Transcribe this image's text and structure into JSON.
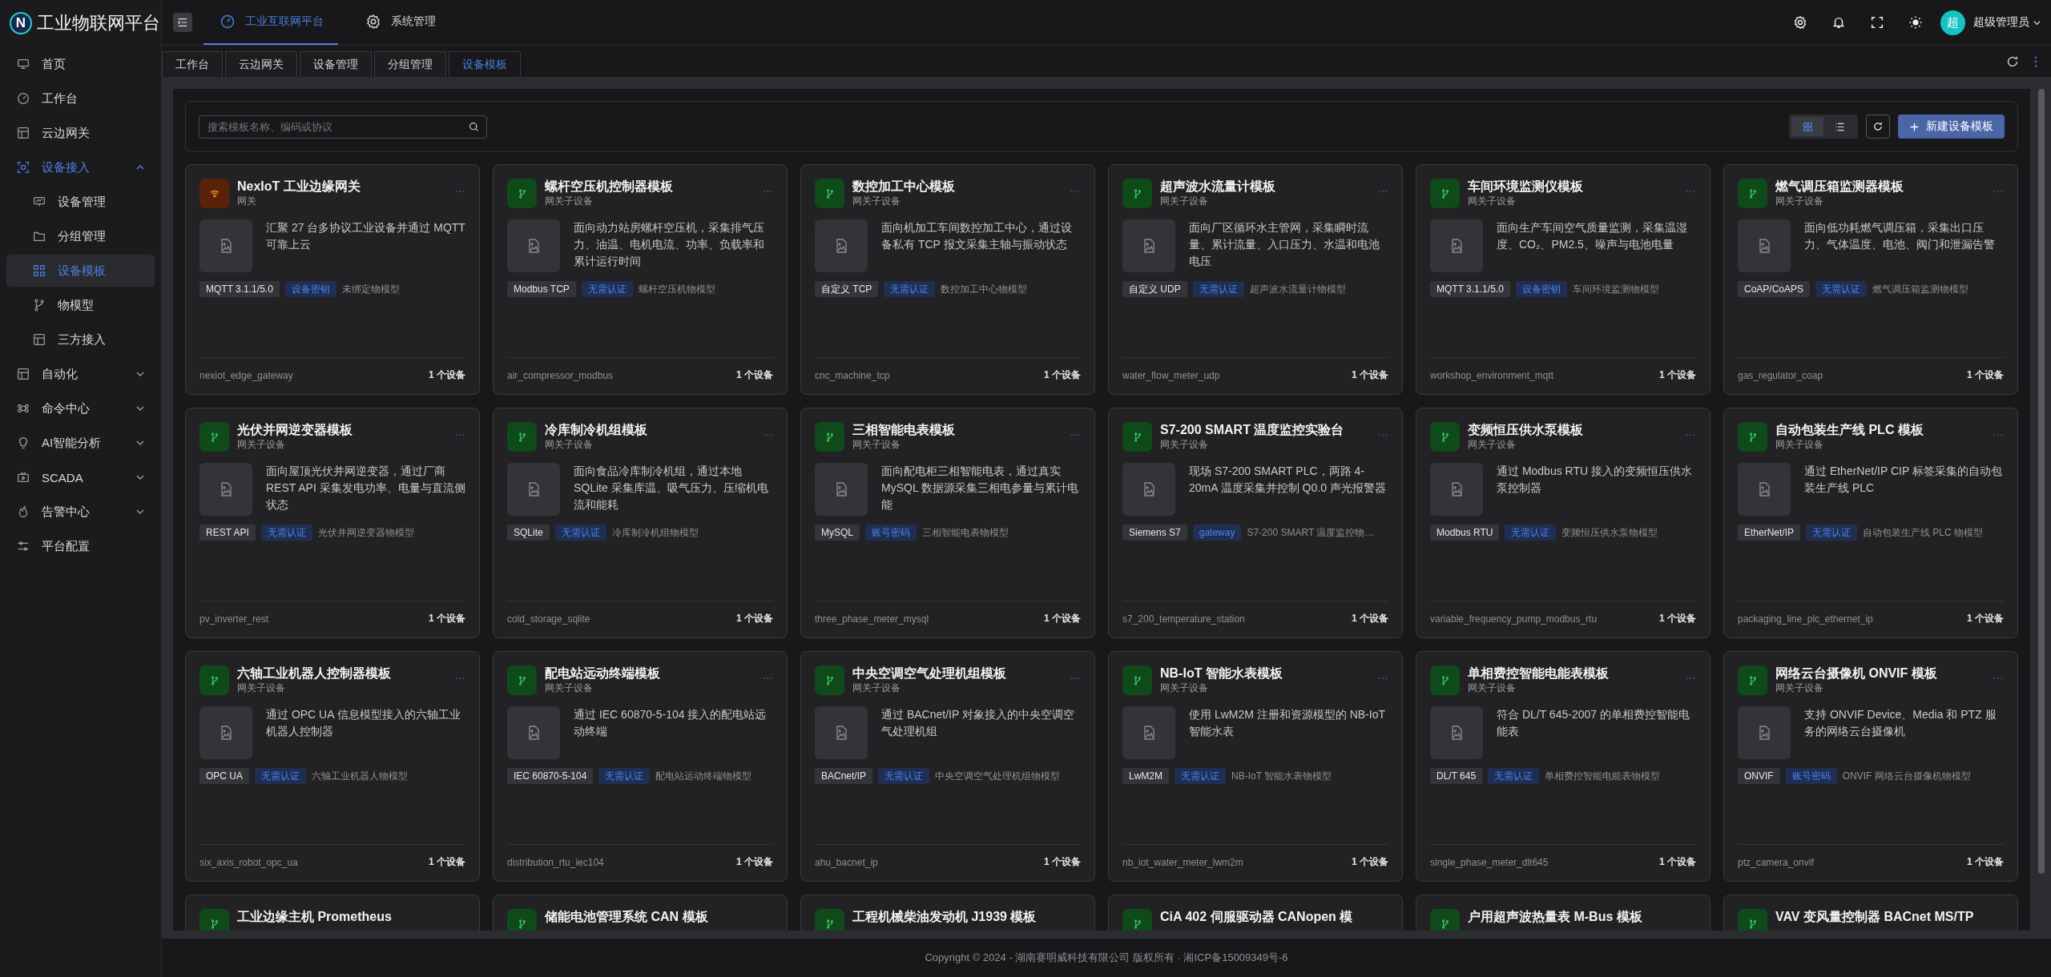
{
  "brand": {
    "logo_mark": "N",
    "title": "工业物联网平台"
  },
  "sidebar": {
    "items": [
      {
        "label": "首页",
        "kind": "link"
      },
      {
        "label": "工作台",
        "kind": "link"
      },
      {
        "label": "云边网关",
        "kind": "link"
      },
      {
        "label": "设备接入",
        "kind": "group",
        "expanded": true,
        "children": [
          {
            "label": "设备管理",
            "selected": false
          },
          {
            "label": "分组管理",
            "selected": false
          },
          {
            "label": "设备模板",
            "selected": true
          },
          {
            "label": "物模型",
            "selected": false
          },
          {
            "label": "三方接入",
            "selected": false
          }
        ]
      },
      {
        "label": "自动化",
        "kind": "group",
        "expanded": false
      },
      {
        "label": "命令中心",
        "kind": "group",
        "expanded": false
      },
      {
        "label": "AI智能分析",
        "kind": "group",
        "expanded": false
      },
      {
        "label": "SCADA",
        "kind": "group",
        "expanded": false
      },
      {
        "label": "告警中心",
        "kind": "group",
        "expanded": false
      },
      {
        "label": "平台配置",
        "kind": "link"
      }
    ]
  },
  "top_nav": [
    {
      "label": "工业互联网平台",
      "selected": true
    },
    {
      "label": "系统管理",
      "selected": false
    }
  ],
  "user": {
    "avatar_text": "超",
    "name": "超级管理员"
  },
  "tabs": [
    {
      "label": "工作台",
      "selected": false
    },
    {
      "label": "云边网关",
      "selected": false
    },
    {
      "label": "设备管理",
      "selected": false
    },
    {
      "label": "分组管理",
      "selected": false
    },
    {
      "label": "设备模板",
      "selected": true
    }
  ],
  "toolbar": {
    "search": {
      "placeholder": "搜索模板名称、编码或协议"
    },
    "view_modes": [
      {
        "kind": "grid",
        "selected": true
      },
      {
        "kind": "list",
        "selected": false
      }
    ],
    "create_button": "新建设备模板"
  },
  "cards": [
    {
      "kind": "gateway",
      "title": "NexIoT 工业边缘网关",
      "type": "网关",
      "description": "汇聚 27 台多协议工业设备并通过 MQTT 可靠上云",
      "protocol": "MQTT 3.1.1/5.0",
      "auth": "设备密钥",
      "model": "未绑定物模型",
      "code": "nexiot_edge_gateway",
      "count": "1 个设备"
    },
    {
      "kind": "subdevice",
      "title": "螺杆空压机控制器模板",
      "type": "网关子设备",
      "description": "面向动力站房螺杆空压机，采集排气压力、油温、电机电流、功率、负载率和累计运行时间",
      "protocol": "Modbus TCP",
      "auth": "无需认证",
      "model": "螺杆空压机物模型",
      "code": "air_compressor_modbus",
      "count": "1 个设备"
    },
    {
      "kind": "subdevice",
      "title": "数控加工中心模板",
      "type": "网关子设备",
      "description": "面向机加工车间数控加工中心，通过设备私有 TCP 报文采集主轴与振动状态",
      "protocol": "自定义 TCP",
      "auth": "无需认证",
      "model": "数控加工中心物模型",
      "code": "cnc_machine_tcp",
      "count": "1 个设备"
    },
    {
      "kind": "subdevice",
      "title": "超声波水流量计模板",
      "type": "网关子设备",
      "description": "面向厂区循环水主管网，采集瞬时流量、累计流量、入口压力、水温和电池电压",
      "protocol": "自定义 UDP",
      "auth": "无需认证",
      "model": "超声波水流量计物模型",
      "code": "water_flow_meter_udp",
      "count": "1 个设备"
    },
    {
      "kind": "subdevice",
      "title": "车间环境监测仪模板",
      "type": "网关子设备",
      "description": "面向生产车间空气质量监测，采集温湿度、CO₂、PM2.5、噪声与电池电量",
      "protocol": "MQTT 3.1.1/5.0",
      "auth": "设备密钥",
      "model": "车间环境监测物模型",
      "code": "workshop_environment_mqtt",
      "count": "1 个设备"
    },
    {
      "kind": "subdevice",
      "title": "燃气调压箱监测器模板",
      "type": "网关子设备",
      "description": "面向低功耗燃气调压箱，采集出口压力、气体温度、电池、阀门和泄漏告警",
      "protocol": "CoAP/CoAPS",
      "auth": "无需认证",
      "model": "燃气调压箱监测物模型",
      "code": "gas_regulator_coap",
      "count": "1 个设备"
    },
    {
      "kind": "subdevice",
      "title": "光伏并网逆变器模板",
      "type": "网关子设备",
      "description": "面向屋顶光伏并网逆变器，通过厂商 REST API 采集发电功率、电量与直流侧状态",
      "protocol": "REST API",
      "auth": "无需认证",
      "model": "光伏并网逆变器物模型",
      "code": "pv_inverter_rest",
      "count": "1 个设备"
    },
    {
      "kind": "subdevice",
      "title": "冷库制冷机组模板",
      "type": "网关子设备",
      "description": "面向食品冷库制冷机组，通过本地 SQLite 采集库温、吸气压力、压缩机电流和能耗",
      "protocol": "SQLite",
      "auth": "无需认证",
      "model": "冷库制冷机组物模型",
      "code": "cold_storage_sqlite",
      "count": "1 个设备"
    },
    {
      "kind": "subdevice",
      "title": "三相智能电表模板",
      "type": "网关子设备",
      "description": "面向配电柜三相智能电表，通过真实 MySQL 数据源采集三相电参量与累计电能",
      "protocol": "MySQL",
      "auth": "账号密码",
      "model": "三相智能电表物模型",
      "code": "three_phase_meter_mysql",
      "count": "1 个设备"
    },
    {
      "kind": "subdevice",
      "title": "S7-200 SMART 温度监控实验台",
      "type": "网关子设备",
      "description": "现场 S7-200 SMART PLC，两路 4-20mA 温度采集并控制 Q0.0 声光报警器",
      "protocol": "Siemens S7",
      "auth": "gateway",
      "model": "S7-200 SMART 温度监控物…",
      "code": "s7_200_temperature_station",
      "count": "1 个设备"
    },
    {
      "kind": "subdevice",
      "title": "变频恒压供水泵模板",
      "type": "网关子设备",
      "description": "通过 Modbus RTU 接入的变频恒压供水泵控制器",
      "protocol": "Modbus RTU",
      "auth": "无需认证",
      "model": "变频恒压供水泵物模型",
      "code": "variable_frequency_pump_modbus_rtu",
      "count": "1 个设备"
    },
    {
      "kind": "subdevice",
      "title": "自动包装生产线 PLC 模板",
      "type": "网关子设备",
      "description": "通过 EtherNet/IP CIP 标签采集的自动包装生产线 PLC",
      "protocol": "EtherNet/IP",
      "auth": "无需认证",
      "model": "自动包装生产线 PLC 物模型",
      "code": "packaging_line_plc_ethernet_ip",
      "count": "1 个设备"
    },
    {
      "kind": "subdevice",
      "title": "六轴工业机器人控制器模板",
      "type": "网关子设备",
      "description": "通过 OPC UA 信息模型接入的六轴工业机器人控制器",
      "protocol": "OPC UA",
      "auth": "无需认证",
      "model": "六轴工业机器人物模型",
      "code": "six_axis_robot_opc_ua",
      "count": "1 个设备"
    },
    {
      "kind": "subdevice",
      "title": "配电站远动终端模板",
      "type": "网关子设备",
      "description": "通过 IEC 60870-5-104 接入的配电站远动终端",
      "protocol": "IEC 60870-5-104",
      "auth": "无需认证",
      "model": "配电站远动终端物模型",
      "code": "distribution_rtu_iec104",
      "count": "1 个设备"
    },
    {
      "kind": "subdevice",
      "title": "中央空调空气处理机组模板",
      "type": "网关子设备",
      "description": "通过 BACnet/IP 对象接入的中央空调空气处理机组",
      "protocol": "BACnet/IP",
      "auth": "无需认证",
      "model": "中央空调空气处理机组物模型",
      "code": "ahu_bacnet_ip",
      "count": "1 个设备"
    },
    {
      "kind": "subdevice",
      "title": "NB-IoT 智能水表模板",
      "type": "网关子设备",
      "description": "使用 LwM2M 注册和资源模型的 NB-IoT 智能水表",
      "protocol": "LwM2M",
      "auth": "无需认证",
      "model": "NB-IoT 智能水表物模型",
      "code": "nb_iot_water_meter_lwm2m",
      "count": "1 个设备"
    },
    {
      "kind": "subdevice",
      "title": "单相费控智能电能表模板",
      "type": "网关子设备",
      "description": "符合 DL/T 645-2007 的单相费控智能电能表",
      "protocol": "DL/T 645",
      "auth": "无需认证",
      "model": "单相费控智能电能表物模型",
      "code": "single_phase_meter_dlt645",
      "count": "1 个设备"
    },
    {
      "kind": "subdevice",
      "title": "网络云台摄像机 ONVIF 模板",
      "type": "网关子设备",
      "description": "支持 ONVIF Device、Media 和 PTZ 服务的网络云台摄像机",
      "protocol": "ONVIF",
      "auth": "账号密码",
      "model": "ONVIF 网络云台摄像机物模型",
      "code": "ptz_camera_onvif",
      "count": "1 个设备"
    },
    {
      "kind": "partial",
      "title": "工业边缘主机 Prometheus"
    },
    {
      "kind": "partial",
      "title": "储能电池管理系统 CAN 模板"
    },
    {
      "kind": "partial",
      "title": "工程机械柴油发动机 J1939 模板"
    },
    {
      "kind": "partial",
      "title": "CiA 402 伺服驱动器 CANopen 模"
    },
    {
      "kind": "partial",
      "title": "户用超声波热量表 M-Bus 模板"
    },
    {
      "kind": "partial",
      "title": "VAV 变风量控制器 BACnet MS/TP"
    }
  ],
  "footer": "Copyright © 2024 - 湖南赛明威科技有限公司 版权所有 · 湘ICP备15009349号-6"
}
